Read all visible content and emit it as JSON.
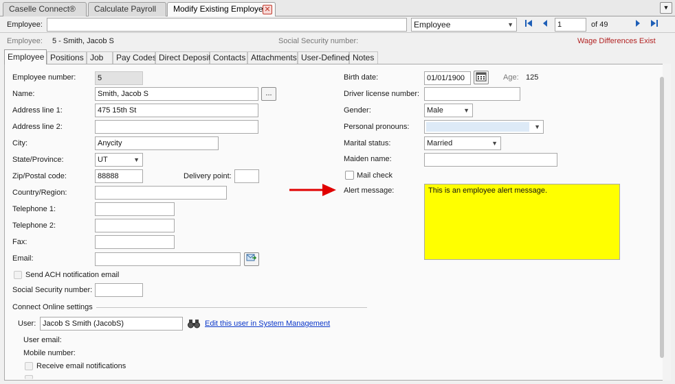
{
  "doc_tabs": [
    {
      "label": "Caselle Connect®"
    },
    {
      "label": "Calculate Payroll"
    },
    {
      "label": "Modify Existing Employees"
    }
  ],
  "close_icon": "✕",
  "toolbar": {
    "employee_label": "Employee:",
    "employee_value": "",
    "lookup_type": "Employee",
    "record_number": "1",
    "record_total": "of 49"
  },
  "info_bar": {
    "employee_label": "Employee:",
    "employee_value": "5 - Smith, Jacob S",
    "ssn_label": "Social Security number:",
    "warning": "Wage Differences Exist",
    "warning_color": "#b22222"
  },
  "sub_tabs": [
    "Employee",
    "Positions",
    "Job",
    "Pay Codes",
    "Direct Deposit",
    "Contacts",
    "Attachments",
    "User-Defined",
    "Notes"
  ],
  "left": {
    "employee_number_label": "Employee number:",
    "employee_number": "5",
    "name_label": "Name:",
    "name": "Smith, Jacob S",
    "name_button": "...",
    "address1_label": "Address line 1:",
    "address1": "475 15th St",
    "address2_label": "Address line 2:",
    "address2": "",
    "city_label": "City:",
    "city": "Anycity",
    "state_label": "State/Province:",
    "state": "UT",
    "zip_label": "Zip/Postal code:",
    "zip": "88888",
    "delivery_label": "Delivery point:",
    "delivery": "",
    "country_label": "Country/Region:",
    "country": "",
    "tel1_label": "Telephone 1:",
    "tel1": "",
    "tel2_label": "Telephone 2:",
    "tel2": "",
    "fax_label": "Fax:",
    "fax": "",
    "email_label": "Email:",
    "email": "",
    "ach_label": "Send ACH notification email",
    "ssn_label": "Social Security number:",
    "ssn": ""
  },
  "connect": {
    "heading": "Connect Online settings",
    "user_label": "User:",
    "user_value": "Jacob S Smith (JacobS)",
    "edit_link": "Edit this user in System Management",
    "user_email_label": "User email:",
    "mobile_label": "Mobile number:",
    "receive_label": "Receive email notifications"
  },
  "right": {
    "birth_label": "Birth date:",
    "birth": "01/01/1900",
    "age_label": "Age:",
    "age": "125",
    "driver_label": "Driver license number:",
    "driver": "",
    "gender_label": "Gender:",
    "gender": "Male",
    "pronouns_label": "Personal pronouns:",
    "pronouns": "",
    "marital_label": "Marital status:",
    "marital": "Married",
    "maiden_label": "Maiden name:",
    "maiden": "",
    "mail_check_label": "Mail check",
    "alert_label": "Alert message:",
    "alert_message": "This is an employee alert message.",
    "alert_color": "#ffff00",
    "arrow_color": "#e00000"
  }
}
